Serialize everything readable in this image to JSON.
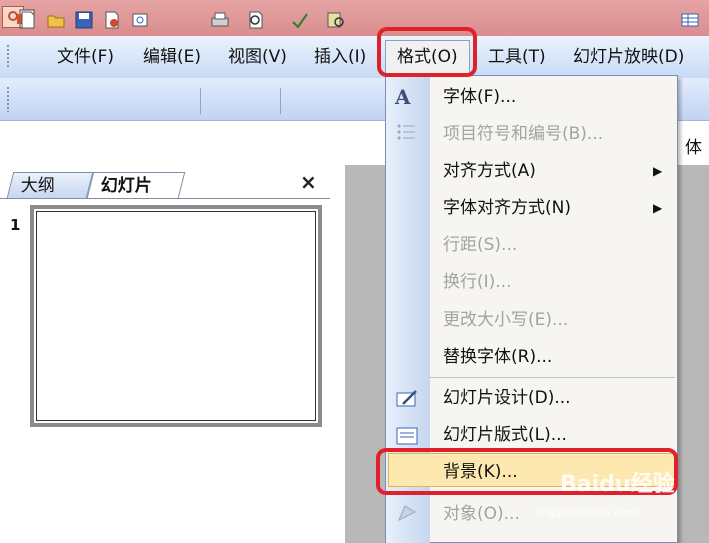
{
  "menu": {
    "items": [
      "文件(F)",
      "编辑(E)",
      "视图(V)",
      "插入(I)",
      "格式(O)",
      "工具(T)",
      "幻灯片放映(D)"
    ]
  },
  "panel": {
    "tabs": [
      "大纲",
      "幻灯片"
    ],
    "close": "×",
    "slide_number": "1"
  },
  "right_partial_text": "体",
  "dropdown": {
    "items": [
      {
        "label": "字体(F)...",
        "disabled": false
      },
      {
        "label": "项目符号和编号(B)...",
        "disabled": true
      },
      {
        "label": "对齐方式(A)",
        "disabled": false,
        "submenu": true
      },
      {
        "label": "字体对齐方式(N)",
        "disabled": false,
        "submenu": true
      },
      {
        "label": "行距(S)...",
        "disabled": true
      },
      {
        "label": "换行(I)...",
        "disabled": true
      },
      {
        "label": "更改大小写(E)...",
        "disabled": true
      },
      {
        "label": "替换字体(R)...",
        "disabled": false
      },
      {
        "label": "幻灯片设计(D)...",
        "disabled": false
      },
      {
        "label": "幻灯片版式(L)...",
        "disabled": false
      },
      {
        "label": "背景(K)...",
        "disabled": false,
        "highlighted": true
      },
      {
        "label": "对象(O)...",
        "disabled": true
      }
    ],
    "submenu_arrow": "▶"
  },
  "watermark": {
    "brand": "Baidu经验",
    "url": "jingyan.baidu.com"
  },
  "colors": {
    "highlight": "#fde9b0",
    "annotation_red": "#e0202a",
    "slide_area": "#b8b8b8"
  }
}
